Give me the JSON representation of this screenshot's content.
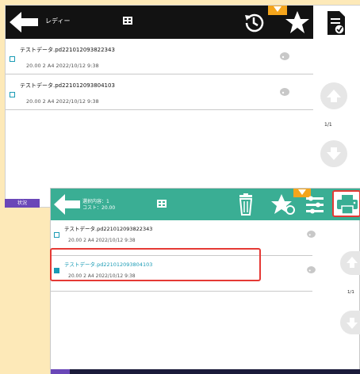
{
  "screen1": {
    "header": {
      "title": "レディー"
    },
    "rows": [
      {
        "name": "テストデータ.pd221012093822343",
        "meta": "20.00  2  A4  2022/10/12 9:38"
      },
      {
        "name": "テストデータ.pd221012093804103",
        "meta": "20.00  2  A4  2022/10/12 9:38"
      }
    ],
    "page": "1/1",
    "status_label": "状況"
  },
  "screen2": {
    "header": {
      "selection": "選択内容：1",
      "cost": "コスト：20.00"
    },
    "rows": [
      {
        "name": "テストデータ.pd221012093822343",
        "meta": "20.00  2  A4  2022/10/12 9:38",
        "selected": false
      },
      {
        "name": "テストデータ.pd221012093804103",
        "meta": "20.00  2  A4  2022/10/12 9:38",
        "selected": true
      }
    ],
    "page": "1/1"
  },
  "colors": {
    "header_dark": "#121212",
    "header_green": "#3aae94",
    "accent_orange": "#f4a51c",
    "checkbox_blue": "#1a9bb5",
    "highlight_red": "#e53935",
    "status_purple": "#6a47b8",
    "background": "#fde9b8"
  },
  "icons": [
    "back-arrow-icon",
    "grid-icon",
    "history-icon",
    "star-icon",
    "document-check-icon",
    "palette-icon",
    "chevron-up-icon",
    "chevron-down-icon",
    "trash-icon",
    "star-settings-icon",
    "settings-icon",
    "printer-icon"
  ]
}
